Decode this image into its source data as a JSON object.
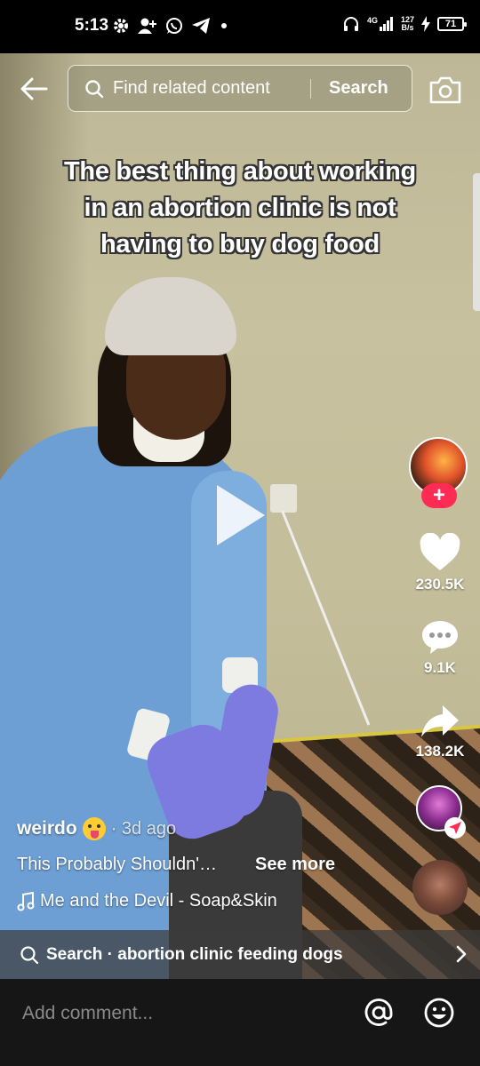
{
  "status_bar": {
    "time": "5:13",
    "network_speed_value": "127",
    "network_speed_unit": "B/s",
    "network_type": "4G",
    "battery": "71",
    "left_icons": [
      "settings-gear-icon",
      "add-person-icon",
      "whatsapp-icon",
      "telegram-icon",
      "dot-icon"
    ],
    "right_icons": [
      "headphones-icon",
      "signal-icon",
      "charging-icon",
      "battery-icon"
    ]
  },
  "top_bar": {
    "search_placeholder": "Find related content",
    "search_button": "Search"
  },
  "video": {
    "caption_lines": [
      "The best thing about working",
      "in an abortion clinic is not",
      "having to buy dog food"
    ],
    "state": "paused"
  },
  "actions": {
    "likes": "230.5K",
    "comments": "9.1K",
    "shares": "138.2K"
  },
  "post": {
    "username": "weirdo",
    "time_ago": "· 3d ago",
    "description": "This Probably Shouldn'…",
    "see_more": "See more",
    "music": "Me and the Devil - Soap&Skin"
  },
  "related_search": {
    "text": "Search · abortion clinic feeding dogs"
  },
  "comment_bar": {
    "placeholder": "Add comment..."
  },
  "colors": {
    "accent_red": "#fe2c55",
    "background": "#000000",
    "comment_bar": "#161616"
  }
}
